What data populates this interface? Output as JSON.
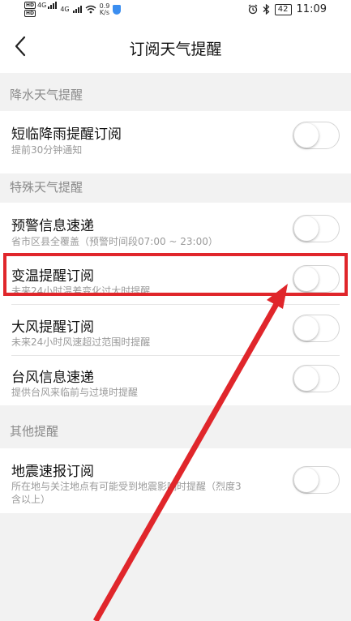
{
  "status_bar": {
    "sim1": "HD",
    "sim2": "HD",
    "network1": "4G",
    "network2": "4G",
    "speed_value": "0.9",
    "speed_unit": "K/s",
    "battery": "42",
    "time": "11:09"
  },
  "header": {
    "title": "订阅天气提醒"
  },
  "sections": {
    "rain": {
      "label": "降水天气提醒",
      "items": [
        {
          "title": "短临降雨提醒订阅",
          "subtitle": "提前30分钟通知",
          "enabled": false
        }
      ]
    },
    "special": {
      "label": "特殊天气提醒",
      "items": [
        {
          "title": "预警信息速递",
          "subtitle": "省市区县全覆盖（预警时间段07:00 ~ 23:00）",
          "enabled": false
        },
        {
          "title": "变温提醒订阅",
          "subtitle": "未来24小时温差变化过大时提醒",
          "enabled": false
        },
        {
          "title": "大风提醒订阅",
          "subtitle": "未来24小时风速超过范围时提醒",
          "enabled": false
        },
        {
          "title": "台风信息速递",
          "subtitle": "提供台风来临前与过境时提醒",
          "enabled": false
        }
      ]
    },
    "other": {
      "label": "其他提醒",
      "items": [
        {
          "title": "地震速报订阅",
          "subtitle_line1": "所在地与关注地点有可能受到地震影响时提醒（烈度3",
          "subtitle_line2": "含以上）",
          "enabled": false
        }
      ]
    }
  },
  "annotation": {
    "color": "#e0262b"
  }
}
